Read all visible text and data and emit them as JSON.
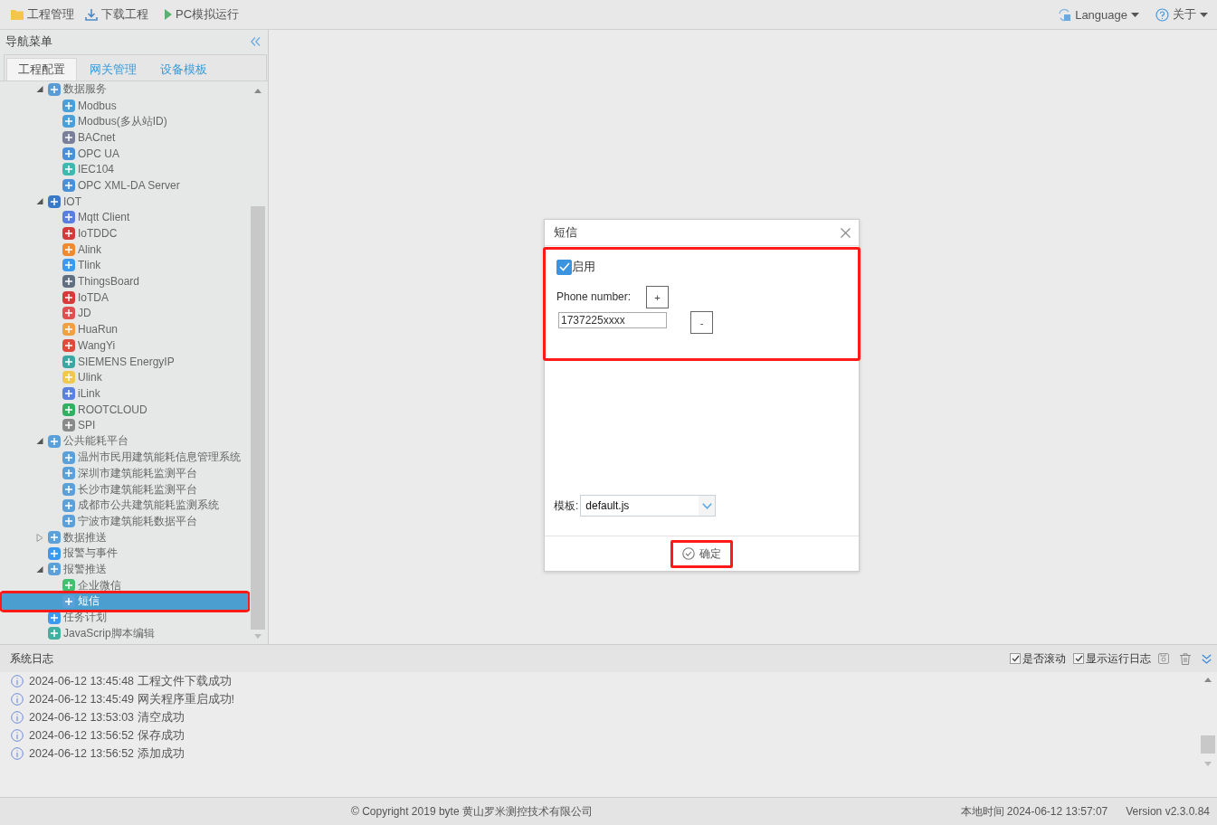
{
  "toolbar": {
    "left": [
      {
        "label": "工程管理"
      },
      {
        "label": "下载工程"
      },
      {
        "label": "PC模拟运行"
      }
    ],
    "right": [
      {
        "label": "Language"
      },
      {
        "label": "关于"
      }
    ]
  },
  "sidebar": {
    "title": "导航菜单",
    "tabs": [
      {
        "label": "工程配置",
        "selected": true
      },
      {
        "label": "网关管理",
        "selected": false
      },
      {
        "label": "设备模板",
        "selected": false
      }
    ],
    "tree": [
      {
        "label": "数据服务",
        "expanded": true,
        "selected": false,
        "color": "#5b9bd5",
        "children": [
          {
            "label": "Modbus",
            "selected": false,
            "color": "#4a9fd8"
          },
          {
            "label": "Modbus(多从站ID)",
            "selected": false,
            "color": "#4a9fd8"
          },
          {
            "label": "BACnet",
            "selected": false,
            "color": "#7a7f9a"
          },
          {
            "label": "OPC UA",
            "selected": false,
            "color": "#4a90d8"
          },
          {
            "label": "IEC104",
            "selected": false,
            "color": "#3fb8b0"
          },
          {
            "label": "OPC XML-DA Server",
            "selected": false,
            "color": "#4a90d8"
          }
        ]
      },
      {
        "label": "IOT",
        "expanded": true,
        "selected": false,
        "color": "#3a78c8",
        "children": [
          {
            "label": "Mqtt Client",
            "selected": false,
            "color": "#5b7fe0"
          },
          {
            "label": "IoTDDC",
            "selected": false,
            "color": "#d33a3a"
          },
          {
            "label": "Alink",
            "selected": false,
            "color": "#f08a30"
          },
          {
            "label": "Tlink",
            "selected": false,
            "color": "#3a9af0"
          },
          {
            "label": "ThingsBoard",
            "selected": false,
            "color": "#607080"
          },
          {
            "label": "IoTDA",
            "selected": false,
            "color": "#d83a3a"
          },
          {
            "label": "JD",
            "selected": false,
            "color": "#e05050"
          },
          {
            "label": "HuaRun",
            "selected": false,
            "color": "#f0a040"
          },
          {
            "label": "WangYi",
            "selected": false,
            "color": "#e04a3a"
          },
          {
            "label": "SIEMENS EnergyIP",
            "selected": false,
            "color": "#3aa8a0"
          },
          {
            "label": "Ulink",
            "selected": false,
            "color": "#f0c850"
          },
          {
            "label": "iLink",
            "selected": false,
            "color": "#5a80e0"
          },
          {
            "label": "ROOTCLOUD",
            "selected": false,
            "color": "#30b060"
          },
          {
            "label": "SPI",
            "selected": false,
            "color": "#8a8a8a"
          }
        ]
      },
      {
        "label": "公共能耗平台",
        "expanded": true,
        "selected": false,
        "color": "#5ba0d8",
        "children": [
          {
            "label": "温州市民用建筑能耗信息管理系统",
            "selected": false,
            "color": "#5ba0d8"
          },
          {
            "label": "深圳市建筑能耗监测平台",
            "selected": false,
            "color": "#5ba0d8"
          },
          {
            "label": "长沙市建筑能耗监测平台",
            "selected": false,
            "color": "#5ba0d8"
          },
          {
            "label": "成都市公共建筑能耗监测系统",
            "selected": false,
            "color": "#5ba0d8"
          },
          {
            "label": "宁波市建筑能耗数据平台",
            "selected": false,
            "color": "#5ba0d8"
          }
        ]
      },
      {
        "label": "数据推送",
        "expanded": false,
        "selected": false,
        "color": "#5ba0d8"
      },
      {
        "label": "报警与事件",
        "selected": false,
        "color": "#3a9af0"
      },
      {
        "label": "报警推送",
        "expanded": true,
        "selected": false,
        "color": "#5ba0d8",
        "children": [
          {
            "label": "企业微信",
            "selected": false,
            "color": "#40c070"
          },
          {
            "label": "短信",
            "selected": true,
            "annotated": true,
            "color": "#5ba0d8"
          }
        ]
      },
      {
        "label": "任务计划",
        "selected": false,
        "color": "#3a9af0"
      },
      {
        "label": "JavaScrip脚本编辑",
        "selected": false,
        "color": "#40b0a0"
      }
    ]
  },
  "dialog": {
    "title": "短信",
    "annotated": true,
    "enable": {
      "label": "启用",
      "checked": true
    },
    "phone_label": "Phone number:",
    "add_button": "+",
    "phone_value": "1737225xxxx",
    "remove_button": "-",
    "template_label": "模板:",
    "template_value": "default.js",
    "ok_button": {
      "label": "确定",
      "annotated": true
    }
  },
  "log": {
    "title": "系统日志",
    "options": [
      {
        "label": "是否滚动",
        "checked": true
      },
      {
        "label": "显示运行日志",
        "checked": true
      }
    ],
    "entries": [
      {
        "time": "2024-06-12 13:45:48",
        "message": "工程文件下载成功"
      },
      {
        "time": "2024-06-12 13:45:49",
        "message": "网关程序重启成功!"
      },
      {
        "time": "2024-06-12 13:53:03",
        "message": "清空成功"
      },
      {
        "time": "2024-06-12 13:56:52",
        "message": "保存成功"
      },
      {
        "time": "2024-06-12 13:56:52",
        "message": "添加成功"
      }
    ]
  },
  "status_bar": {
    "copyright": "© Copyright 2019 byte 黄山罗米测控技术有限公司",
    "local_time": "本地时间 2024-06-12 13:57:07",
    "version": "Version v2.3.0.84"
  }
}
